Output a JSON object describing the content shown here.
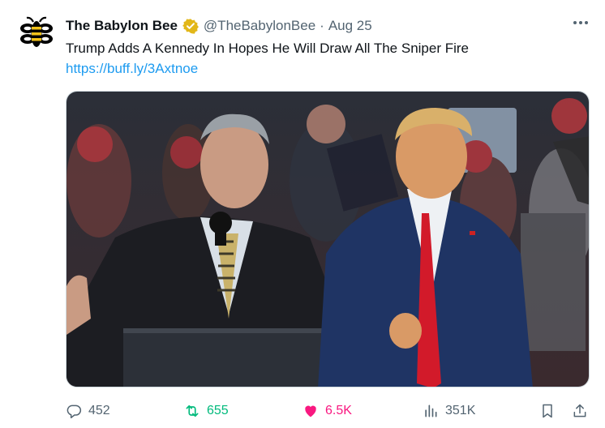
{
  "tweet": {
    "account_name": "The Babylon Bee",
    "handle": "@TheBabylonBee",
    "separator": "·",
    "date": "Aug 25",
    "text": "Trump Adds A Kennedy In Hopes He Will Draw All The Sniper Fire",
    "link": "https://buff.ly/3Axtnoe",
    "verified": true,
    "verified_badge_color": "#e2b719",
    "link_color": "#1d9bf0"
  },
  "icons": {
    "avatar": "bee-logo-icon",
    "verified": "verified-badge-icon",
    "more": "more-options-icon",
    "reply": "reply-icon",
    "retweet": "retweet-icon",
    "like": "heart-icon",
    "views": "views-chart-icon",
    "bookmark": "bookmark-icon",
    "share": "share-icon"
  },
  "actions": {
    "replies": "452",
    "retweets": "655",
    "likes": "6.5K",
    "views": "351K"
  },
  "colors": {
    "retweet": "#00ba7c",
    "like": "#f91880",
    "muted": "#536471"
  }
}
